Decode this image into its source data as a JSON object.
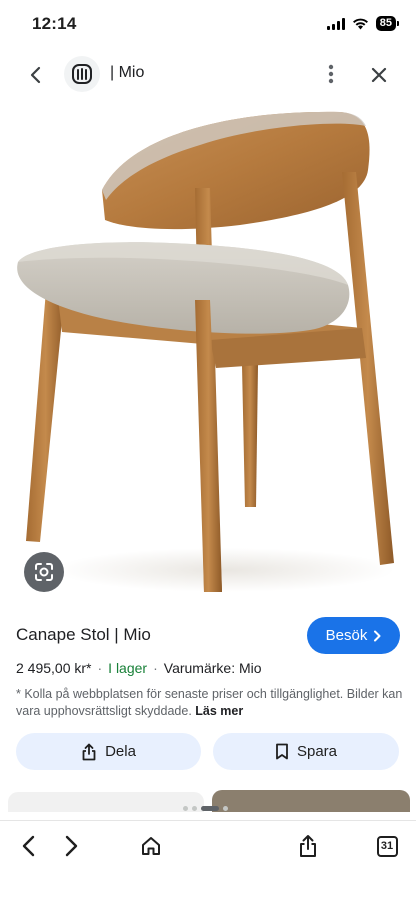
{
  "status_bar": {
    "time": "12:14",
    "battery": "85"
  },
  "header": {
    "site_title": "| Mio"
  },
  "product": {
    "title": "Canape Stol | Mio",
    "visit_label": "Besök",
    "price": "2 495,00 kr*",
    "stock": "I lager",
    "brand": "Varumärke: Mio",
    "disclaimer": "* Kolla på webbplatsen för senaste priser och tillgänglighet. Bilder kan vara upphovsrättsligt skyddade.",
    "read_more": "Läs mer"
  },
  "actions": {
    "share_label": "Dela",
    "save_label": "Spara"
  },
  "toolbar": {
    "tabs_count": "31"
  },
  "colors": {
    "accent": "#1a73e8",
    "stock_green": "#188038",
    "chip_bg": "#e8f0fe"
  }
}
